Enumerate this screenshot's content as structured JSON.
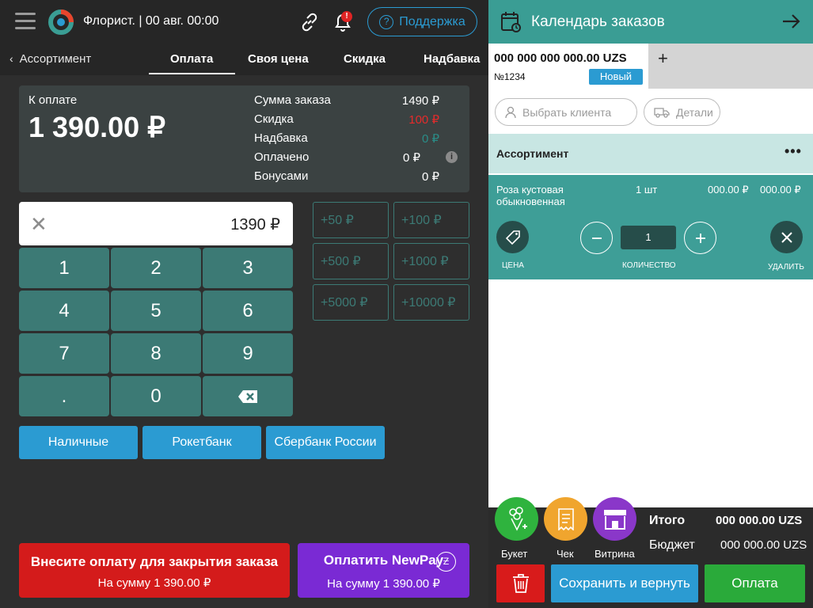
{
  "header": {
    "brand": "Флорист. | 00 авг. 00:00",
    "notification_badge": "!",
    "support_label": "Поддержка"
  },
  "tabs": {
    "back_label": "Ассортимент",
    "items": [
      "Оплата",
      "Своя цена",
      "Скидка",
      "Надбавка"
    ],
    "active": "Оплата"
  },
  "summary": {
    "due_label": "К оплате",
    "due_amount": "1 390.00 ₽",
    "rows": [
      {
        "label": "Сумма заказа",
        "value": "1490 ₽"
      },
      {
        "label": "Скидка",
        "value": "100 ₽"
      },
      {
        "label": "Надбавка",
        "value": "0 ₽"
      },
      {
        "label": "Оплачено",
        "value": "0 ₽"
      },
      {
        "label": "Бонусами",
        "value": "0 ₽"
      }
    ]
  },
  "entry": {
    "value": "1390 ₽"
  },
  "keypad": [
    "1",
    "2",
    "3",
    "4",
    "5",
    "6",
    "7",
    "8",
    "9",
    ".",
    "0"
  ],
  "quick_amounts": [
    "+50 ₽",
    "+100 ₽",
    "+500 ₽",
    "+1000 ₽",
    "+5000 ₽",
    "+10000 ₽"
  ],
  "payment_methods": [
    "Наличные",
    "Рокетбанк",
    "Сбербанк России"
  ],
  "actions": {
    "close_title": "Внесите оплату для закрытия заказа",
    "close_sub": "На сумму 1 390.00 ₽",
    "newpay_title": "Оплатить NewPay",
    "newpay_sub": "На сумму 1 390.00 ₽"
  },
  "right": {
    "title": "Календарь заказов",
    "order": {
      "amount": "000 000 000 000.00 UZS",
      "number": "№1234",
      "status": "Новый"
    },
    "add_tab": "+",
    "client_placeholder": "Выбрать клиента",
    "details_label": "Детали",
    "section_title": "Ассортимент",
    "more": "•••",
    "item": {
      "name": "Роза кустовая обыкновенная",
      "qty": "1 шт",
      "price": "000.00 ₽",
      "total": "000.00 ₽",
      "qty_value": "1",
      "price_caption": "ЦЕНА",
      "qty_caption": "КОЛИЧЕСТВО",
      "delete_caption": "УДАЛИТЬ"
    },
    "bottom": {
      "bouquet": "Букет",
      "receipt": "Чек",
      "showcase": "Витрина",
      "total_label": "Итого",
      "total_value": "000 000.00 UZS",
      "budget_label": "Бюджет",
      "budget_value": "000 000.00 UZS",
      "save_label": "Сохранить и вернуть",
      "pay_label": "Оплата"
    }
  },
  "colors": {
    "accent_teal": "#3e9e97",
    "accent_blue": "#2b9bd2",
    "danger": "#d41b1b",
    "newpay": "#7a2ad4",
    "success": "#2aaa3a"
  }
}
